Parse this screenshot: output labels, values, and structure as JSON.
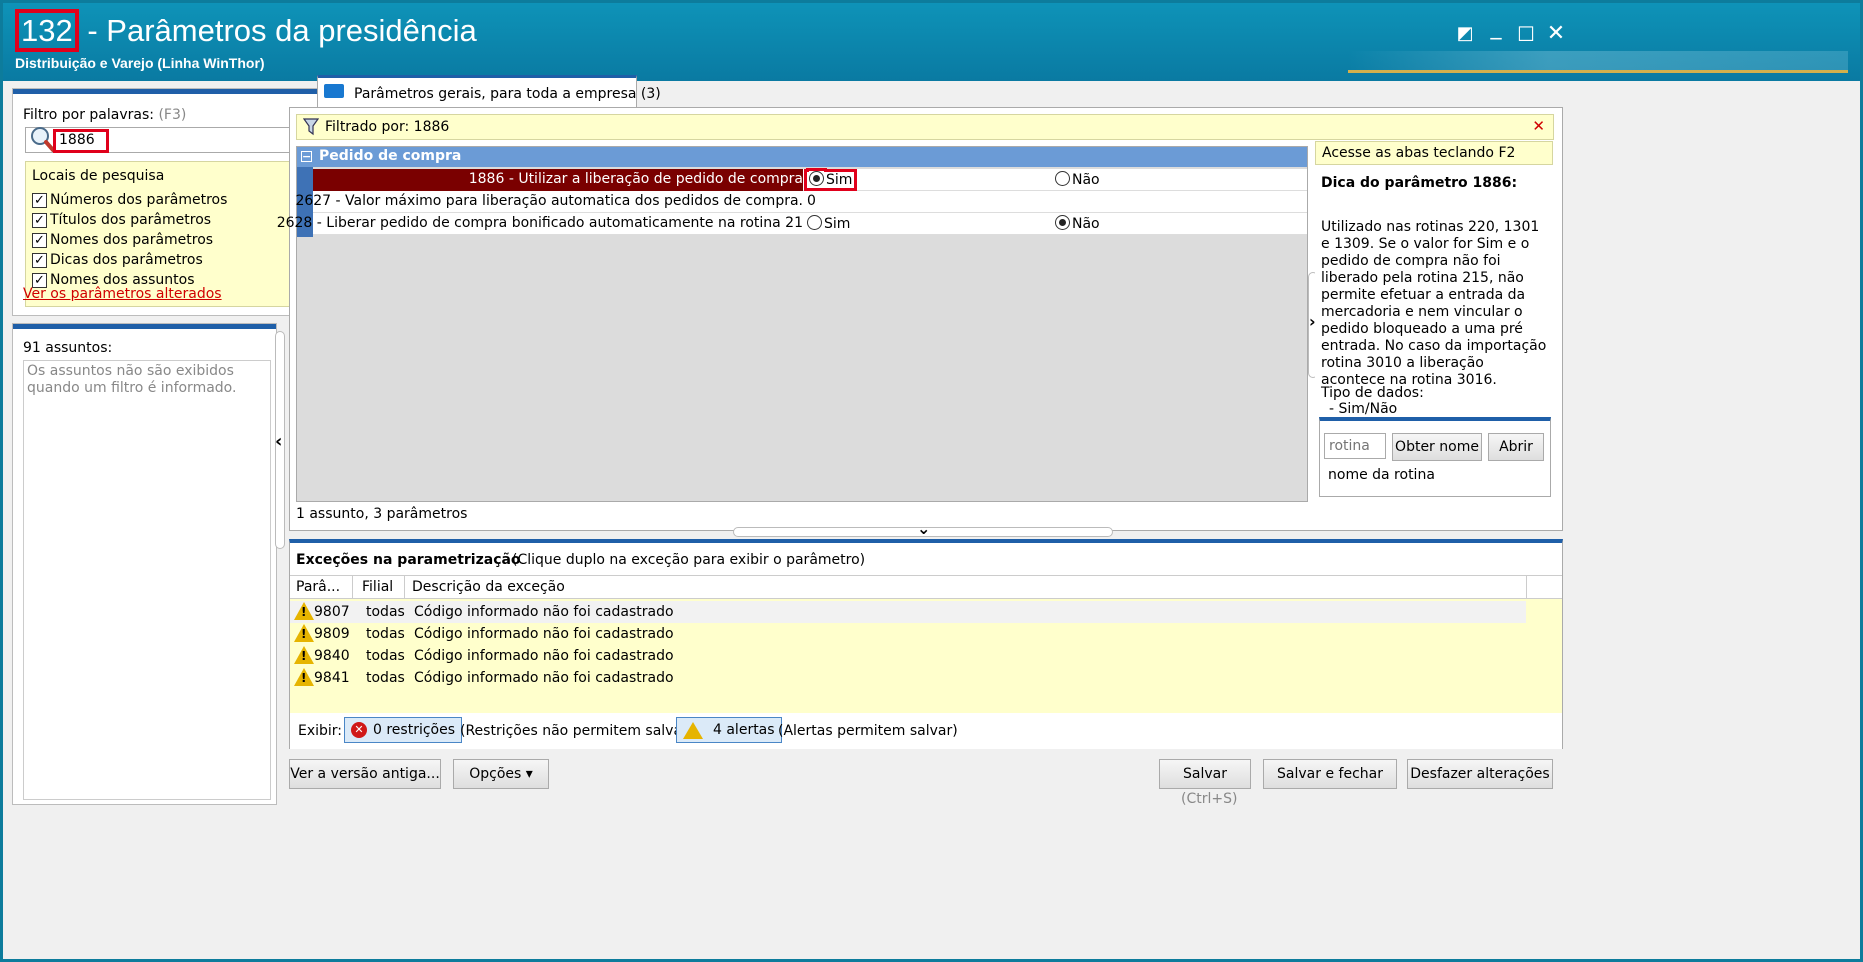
{
  "window": {
    "routine_number": "132",
    "title_rest": " - Parâmetros da presidência",
    "subtitle": "Distribuição e Varejo (Linha WinThor)"
  },
  "titlebar_icons": [
    "restore-icon",
    "minimize-icon",
    "maximize-icon",
    "close-icon"
  ],
  "titlebar_glyphs": {
    "restore": "◩",
    "minimize": "_",
    "maximize": "☐",
    "close": "✕"
  },
  "filter": {
    "label": "Filtro por palavras:",
    "hint": "(F3)",
    "value": "1886",
    "clear": "✕",
    "locations_title": "Locais de pesquisa",
    "collapse_glyph": "︽",
    "locations": [
      {
        "label": "Números dos parâmetros",
        "checked": true
      },
      {
        "label": "Títulos dos parâmetros",
        "checked": true
      },
      {
        "label": "Nomes dos parâmetros",
        "checked": true
      },
      {
        "label": "Dicas dos parâmetros",
        "checked": true
      },
      {
        "label": "Nomes dos assuntos",
        "checked": true
      }
    ],
    "check_glyph": "✓",
    "changed_link": "Ver os parâmetros alterados"
  },
  "subjects": {
    "count_label": "91 assuntos:",
    "note": "Os assuntos não são exibidos quando um filtro é informado."
  },
  "tab": {
    "label": "Parâmetros gerais, para toda a empresa  (3)"
  },
  "filterbar": {
    "text": "Filtrado por: 1886",
    "close": "✕"
  },
  "grid": {
    "group": "Pedido de compra",
    "expand_glyph": "−",
    "rows": [
      {
        "name": "1886 - Utilizar a liberação de pedido de compra",
        "type": "radio",
        "yes": "Sim",
        "no": "Não",
        "selected": "Sim"
      },
      {
        "name": "2627 - Valor máximo para liberação automatica dos pedidos de compra.",
        "type": "value",
        "value": "0"
      },
      {
        "name": "2628 - Liberar pedido de compra bonificado automaticamente na rotina 21",
        "type": "radio",
        "yes": "Sim",
        "no": "Não",
        "selected": "Não"
      }
    ],
    "status": "1 assunto, 3 parâmetros"
  },
  "hint": {
    "tip": "Acesse as abas teclando F2",
    "title": "Dica do parâmetro 1886:",
    "body": "Utilizado nas rotinas 220, 1301 e 1309. Se o valor for Sim e o pedido de compra não foi liberado pela rotina 215, não permite efetuar a entrada da mercadoria e nem vincular o pedido bloqueado a uma pré entrada. No caso da importação rotina 3010 a liberação acontece na rotina 3016.",
    "type_label": "Tipo de dados:",
    "type_value": "- Sim/Não",
    "routine_placeholder": "rotina",
    "get_name_button": "Obter nome",
    "open_button": "Abrir",
    "routine_name": "nome da rotina"
  },
  "splitter_glyphs": {
    "left": "‹",
    "right": "›",
    "down": "⌄"
  },
  "exceptions": {
    "title": "Exceções na parametrização",
    "subtitle": "(Clique duplo na exceção para exibir o parâmetro)",
    "columns": [
      "Parâ...",
      "Filial",
      "Descrição da exceção"
    ],
    "rows": [
      {
        "param": "9807",
        "branch": "todas",
        "description": "Código informado não foi cadastrado"
      },
      {
        "param": "9809",
        "branch": "todas",
        "description": "Código informado não foi cadastrado"
      },
      {
        "param": "9840",
        "branch": "todas",
        "description": "Código informado não foi cadastrado"
      },
      {
        "param": "9841",
        "branch": "todas",
        "description": "Código informado não foi cadastrado"
      }
    ],
    "show_label": "Exibir:",
    "restrictions_chip": "0 restrições",
    "restrictions_note": "(Restrições não permitem salvar)",
    "alerts_chip": "4 alertas",
    "alerts_note": "(Alertas permitem salvar)"
  },
  "footer": {
    "old_version": "Ver a versão antiga...",
    "options": "Opções ▾",
    "save": "Salvar",
    "save_shortcut": "(Ctrl+S)",
    "save_close": "Salvar e fechar",
    "undo": "Desfazer alterações"
  },
  "colors": {
    "titlebar": "#0a7aa2",
    "highlight_red": "#e0001b",
    "selected_row": "#7a0000",
    "group_header": "#6b9bd6",
    "info_yellow": "#ffffcc",
    "accent_blue": "#1f5fa8"
  }
}
